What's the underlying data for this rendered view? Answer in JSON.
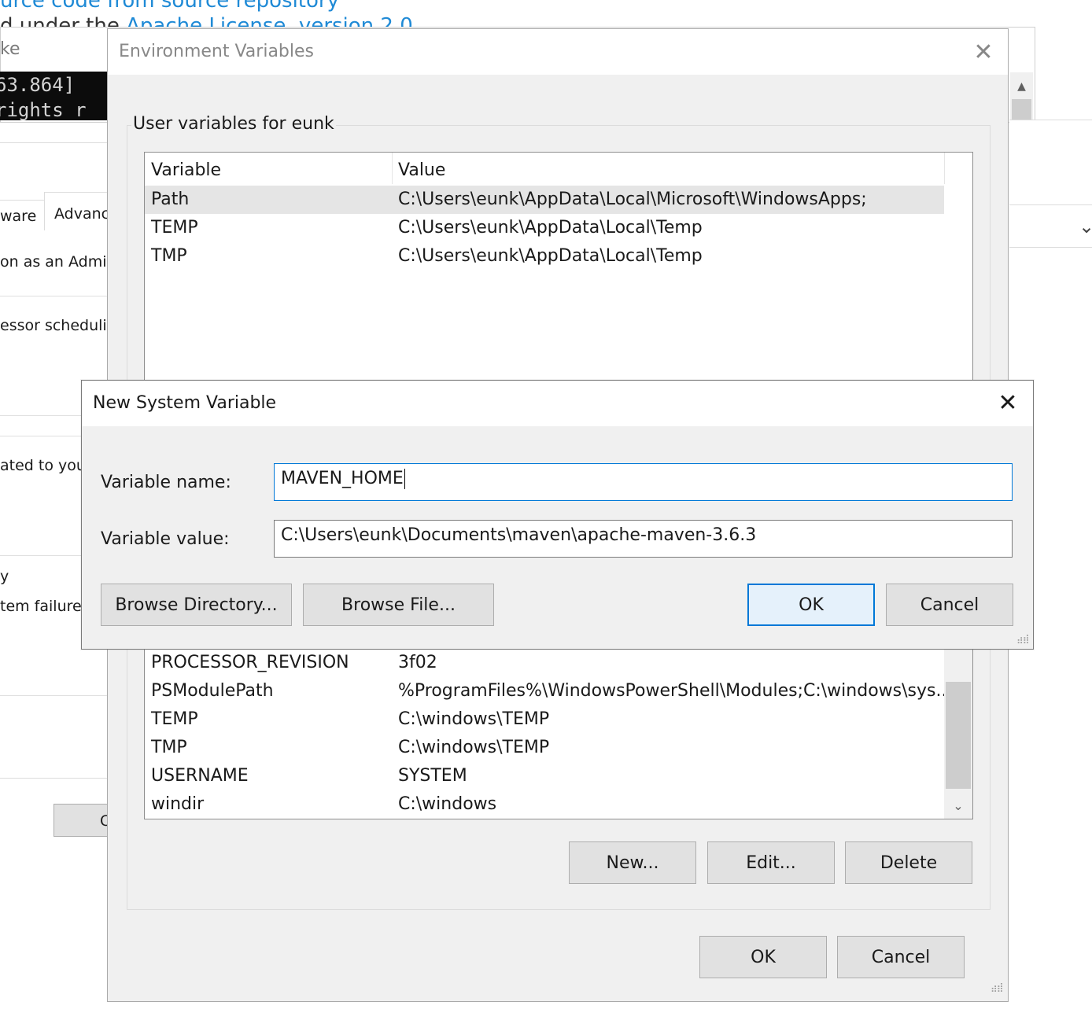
{
  "background": {
    "link_line1": "urce code from source repository",
    "text_line2": "d under the ",
    "link_line2": "Apache License, version 2.0",
    "cmd_title": "ke",
    "cmd_lines": [
      "63.864]",
      " rights r"
    ],
    "sysprops": {
      "tab_hardware": "ware",
      "tab_advanced": "Advanc",
      "text_admin": "on as an Admir",
      "text_processor": "essor schedulir",
      "text_related": "ated to you",
      "text_y": "y",
      "text_failure": "tem failure,",
      "button_partial": "C"
    },
    "right_chevron": "⌄"
  },
  "env_dialog": {
    "title": "Environment Variables",
    "close_glyph": "✕",
    "user_group_label": "User variables for eunk",
    "user_columns": [
      "Variable",
      "Value"
    ],
    "user_rows": [
      {
        "variable": "Path",
        "value": "C:\\Users\\eunk\\AppData\\Local\\Microsoft\\WindowsApps;"
      },
      {
        "variable": "TEMP",
        "value": "C:\\Users\\eunk\\AppData\\Local\\Temp"
      },
      {
        "variable": "TMP",
        "value": "C:\\Users\\eunk\\AppData\\Local\\Temp"
      }
    ],
    "system_rows": [
      {
        "variable": "PROCESSOR_REVISION",
        "value": "3f02"
      },
      {
        "variable": "PSModulePath",
        "value": "%ProgramFiles%\\WindowsPowerShell\\Modules;C:\\windows\\sys..."
      },
      {
        "variable": "TEMP",
        "value": "C:\\windows\\TEMP"
      },
      {
        "variable": "TMP",
        "value": "C:\\windows\\TEMP"
      },
      {
        "variable": "USERNAME",
        "value": "SYSTEM"
      },
      {
        "variable": "windir",
        "value": "C:\\windows"
      }
    ],
    "system_buttons": {
      "new": "New...",
      "edit": "Edit...",
      "delete": "Delete"
    },
    "ok": "OK",
    "cancel": "Cancel"
  },
  "new_var_dialog": {
    "title": "New System Variable",
    "close_glyph": "✕",
    "name_label": "Variable name:",
    "name_value": "MAVEN_HOME",
    "value_label": "Variable value:",
    "value_value": "C:\\Users\\eunk\\Documents\\maven\\apache-maven-3.6.3",
    "browse_directory": "Browse Directory...",
    "browse_file": "Browse File...",
    "ok": "OK",
    "cancel": "Cancel"
  },
  "colors": {
    "accent": "#0078d7",
    "link": "#1f8ad6",
    "dialog_bg": "#f0f0f0",
    "selected_row": "#e5e5e5"
  }
}
